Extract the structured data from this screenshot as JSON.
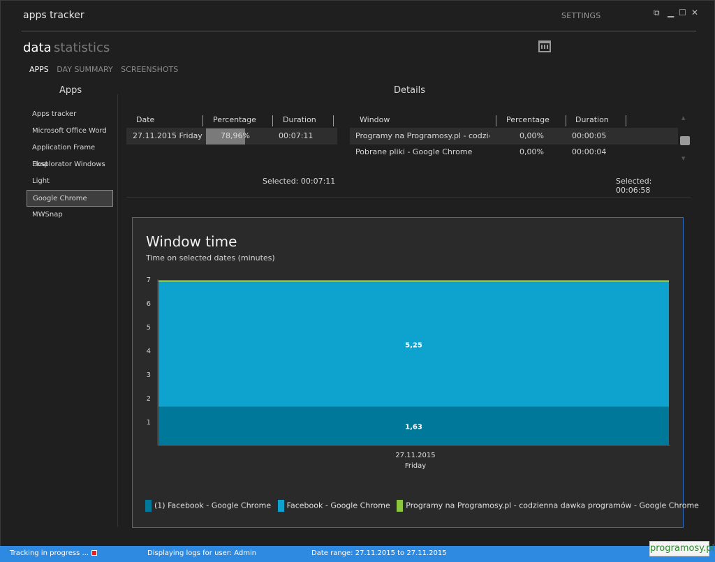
{
  "window": {
    "title": "apps tracker",
    "settings_label": "SETTINGS",
    "icons": [
      "restore-icon",
      "minimize-icon",
      "maximize-icon",
      "close-icon"
    ]
  },
  "header": {
    "data_label": "data",
    "statistics_label": "statistics"
  },
  "tabs": [
    {
      "label": "APPS",
      "active": true
    },
    {
      "label": "DAY SUMMARY",
      "active": false
    },
    {
      "label": "SCREENSHOTS",
      "active": false
    }
  ],
  "apps": {
    "heading": "Apps",
    "items": [
      {
        "label": "Apps tracker"
      },
      {
        "label": "Microsoft Office Word"
      },
      {
        "label": "Application Frame Host"
      },
      {
        "label": "Eksplorator Windows"
      },
      {
        "label": "Light"
      },
      {
        "label": "Google Chrome",
        "selected": true
      },
      {
        "label": "MWSnap"
      }
    ]
  },
  "details": {
    "heading": "Details",
    "dates_table": {
      "columns": [
        "Date",
        "Percentage",
        "Duration"
      ],
      "rows": [
        {
          "date": "27.11.2015 Friday",
          "percentage": "78,96%",
          "percentage_value": 78.96,
          "duration": "00:07:11"
        }
      ],
      "selected": "Selected: 00:07:11"
    },
    "windows_table": {
      "columns": [
        "Window",
        "Percentage",
        "Duration"
      ],
      "rows": [
        {
          "window": "Programy na Programosy.pl - codzie",
          "percentage": "0,00%",
          "duration": "00:00:05"
        },
        {
          "window": "Pobrane pliki - Google Chrome",
          "percentage": "0,00%",
          "duration": "00:00:04"
        }
      ],
      "selected": "Selected: 00:06:58"
    }
  },
  "chart": {
    "title": "Window time",
    "subtitle": "Time on selected dates (minutes)",
    "x_label_line1": "27.11.2015",
    "x_label_line2": "Friday"
  },
  "chart_data": {
    "type": "area",
    "stacked": true,
    "categories": [
      "27.11.2015 Friday"
    ],
    "ylim": [
      0,
      7
    ],
    "yticks": [
      1,
      2,
      3,
      4,
      5,
      6,
      7
    ],
    "series": [
      {
        "name": "(1) Facebook - Google Chrome",
        "values": [
          1.63
        ],
        "color": "#00789a",
        "label": "1,63"
      },
      {
        "name": "Facebook - Google Chrome",
        "values": [
          5.25
        ],
        "color": "#0ea2cf",
        "label": "5,25"
      },
      {
        "name": "Programy na Programosy.pl - codzienna dawka programów - Google Chrome",
        "values": [
          0.08
        ],
        "color": "#8cc63f",
        "label": ""
      }
    ],
    "legend_position": "bottom"
  },
  "status": {
    "tracking": "Tracking in progress ...",
    "user": "Displaying logs for user: Admin",
    "range": "Date range: 27.11.2015 to 27.11.2015"
  },
  "brand": "programosy.pl"
}
